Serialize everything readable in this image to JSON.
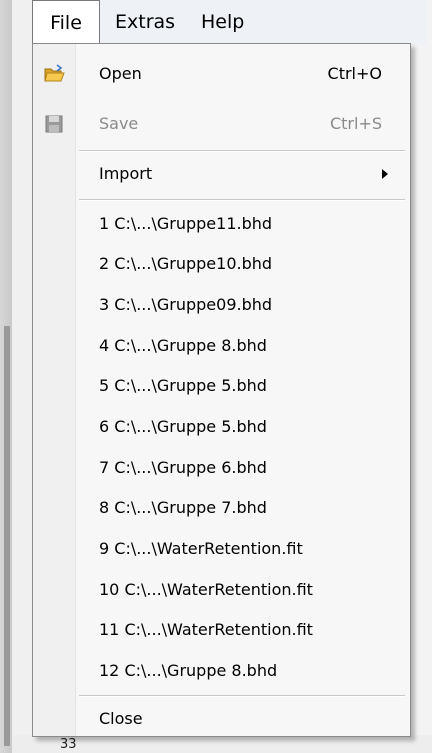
{
  "background": {
    "row_number": "33"
  },
  "menubar": {
    "file": "File",
    "extras": "Extras",
    "help": "Help"
  },
  "menu": {
    "open": {
      "label": "Open",
      "shortcut": "Ctrl+O"
    },
    "save": {
      "label": "Save",
      "shortcut": "Ctrl+S"
    },
    "import": {
      "label": "Import"
    },
    "recent": [
      "1 C:\\...\\Gruppe11.bhd",
      "2 C:\\...\\Gruppe10.bhd",
      "3 C:\\...\\Gruppe09.bhd",
      "4 C:\\...\\Gruppe 8.bhd",
      "5 C:\\...\\Gruppe 5.bhd",
      "6 C:\\...\\Gruppe 5.bhd",
      "7 C:\\...\\Gruppe 6.bhd",
      "8 C:\\...\\Gruppe 7.bhd",
      "9 C:\\...\\WaterRetention.fit",
      "10 C:\\...\\WaterRetention.fit",
      "11 C:\\...\\WaterRetention.fit",
      "12 C:\\...\\Gruppe 8.bhd"
    ],
    "close": {
      "label": "Close"
    }
  }
}
